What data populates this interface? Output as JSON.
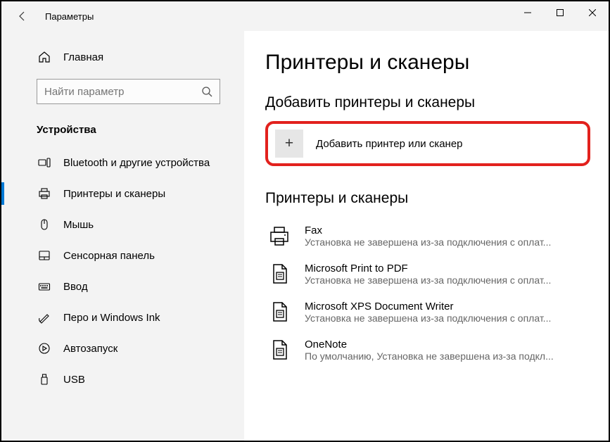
{
  "window_title": "Параметры",
  "home_label": "Главная",
  "search_placeholder": "Найти параметр",
  "category_header": "Устройства",
  "sidebar_items": [
    {
      "label": "Bluetooth и другие устройства"
    },
    {
      "label": "Принтеры и сканеры"
    },
    {
      "label": "Мышь"
    },
    {
      "label": "Сенсорная панель"
    },
    {
      "label": "Ввод"
    },
    {
      "label": "Перо и Windows Ink"
    },
    {
      "label": "Автозапуск"
    },
    {
      "label": "USB"
    }
  ],
  "page_title": "Принтеры и сканеры",
  "add_section_title": "Добавить принтеры и сканеры",
  "add_button_label": "Добавить принтер или сканер",
  "list_section_title": "Принтеры и сканеры",
  "devices": [
    {
      "name": "Fax",
      "status": "Установка не завершена из-за подключения с оплат..."
    },
    {
      "name": "Microsoft Print to PDF",
      "status": "Установка не завершена из-за подключения с оплат..."
    },
    {
      "name": "Microsoft XPS Document Writer",
      "status": "Установка не завершена из-за подключения с оплат..."
    },
    {
      "name": "OneNote",
      "status": "По умолчанию, Установка не завершена из-за подкл..."
    }
  ]
}
